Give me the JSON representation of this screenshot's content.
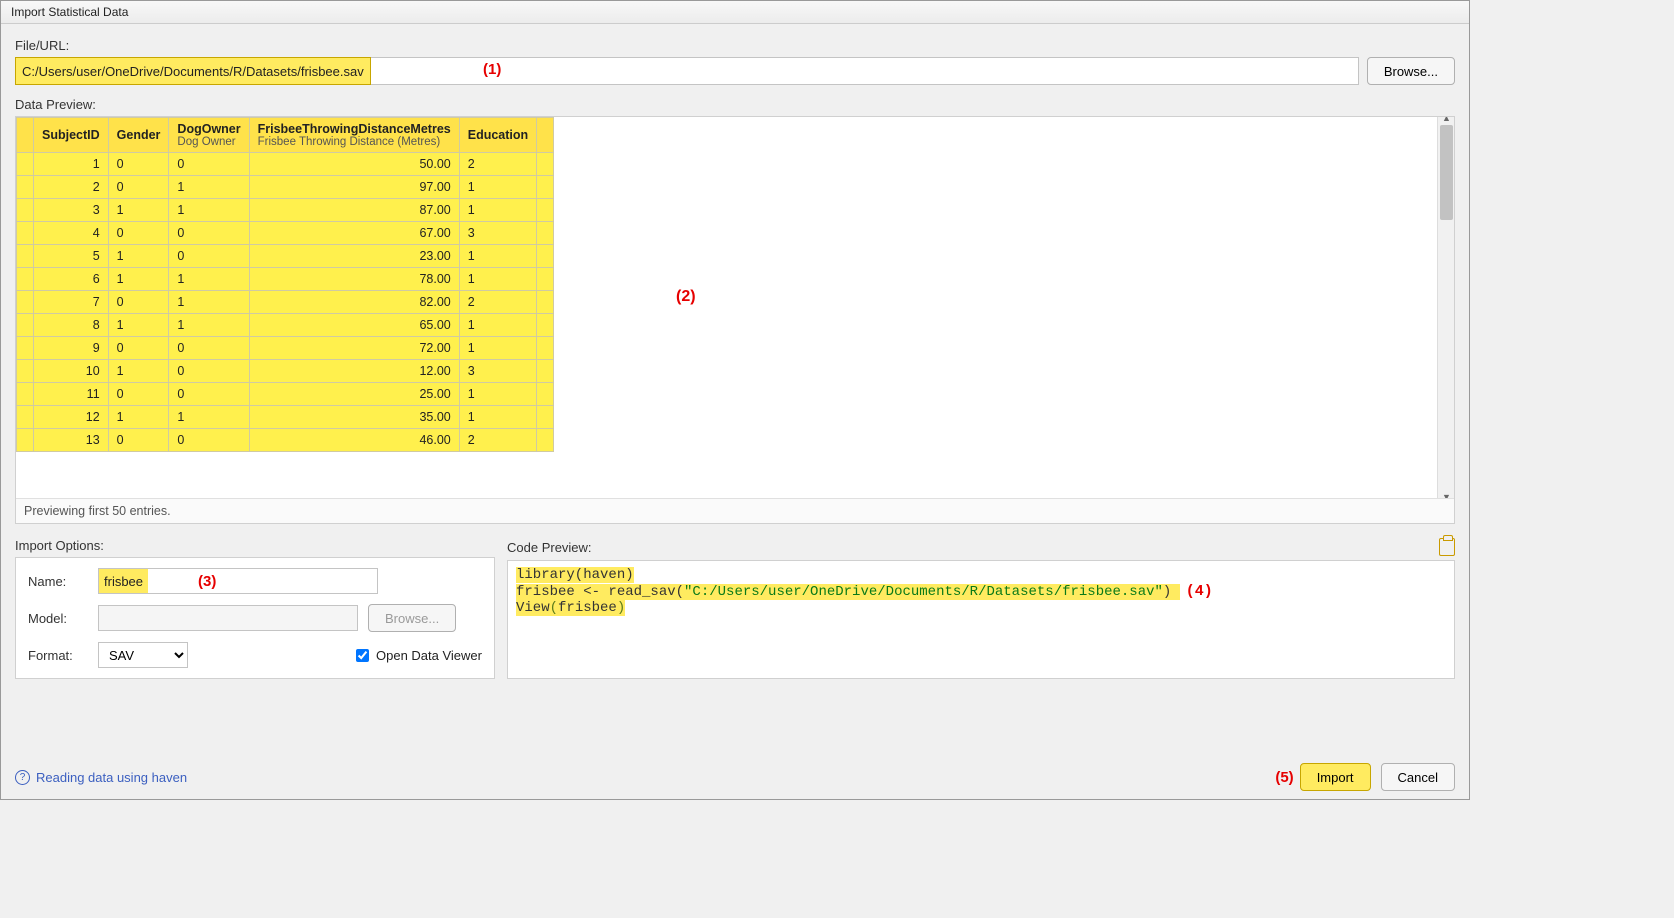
{
  "window_title": "Import Statistical Data",
  "fileurl_label": "File/URL:",
  "fileurl_value": "C:/Users/user/OneDrive/Documents/R/Datasets/frisbee.sav",
  "browse_label": "Browse...",
  "data_preview_label": "Data Preview:",
  "annotation1": "(1)",
  "annotation2": "(2)",
  "annotation3": "(3)",
  "annotation4": "(4)",
  "annotation5": "(5)",
  "columns": [
    {
      "name": "SubjectID",
      "sub": ""
    },
    {
      "name": "Gender",
      "sub": ""
    },
    {
      "name": "DogOwner",
      "sub": "Dog Owner"
    },
    {
      "name": "FrisbeeThrowingDistanceMetres",
      "sub": "Frisbee Throwing Distance (Metres)"
    },
    {
      "name": "Education",
      "sub": ""
    }
  ],
  "rows": [
    {
      "n": "1",
      "g": "0",
      "d": "0",
      "f": "50.00",
      "e": "2"
    },
    {
      "n": "2",
      "g": "0",
      "d": "1",
      "f": "97.00",
      "e": "1"
    },
    {
      "n": "3",
      "g": "1",
      "d": "1",
      "f": "87.00",
      "e": "1"
    },
    {
      "n": "4",
      "g": "0",
      "d": "0",
      "f": "67.00",
      "e": "3"
    },
    {
      "n": "5",
      "g": "1",
      "d": "0",
      "f": "23.00",
      "e": "1"
    },
    {
      "n": "6",
      "g": "1",
      "d": "1",
      "f": "78.00",
      "e": "1"
    },
    {
      "n": "7",
      "g": "0",
      "d": "1",
      "f": "82.00",
      "e": "2"
    },
    {
      "n": "8",
      "g": "1",
      "d": "1",
      "f": "65.00",
      "e": "1"
    },
    {
      "n": "9",
      "g": "0",
      "d": "0",
      "f": "72.00",
      "e": "1"
    },
    {
      "n": "10",
      "g": "1",
      "d": "0",
      "f": "12.00",
      "e": "3"
    },
    {
      "n": "11",
      "g": "0",
      "d": "0",
      "f": "25.00",
      "e": "1"
    },
    {
      "n": "12",
      "g": "1",
      "d": "1",
      "f": "35.00",
      "e": "1"
    },
    {
      "n": "13",
      "g": "0",
      "d": "0",
      "f": "46.00",
      "e": "2"
    }
  ],
  "preview_status": "Previewing first 50 entries.",
  "import_options_title": "Import Options:",
  "io": {
    "name_label": "Name:",
    "name_value": "frisbee",
    "model_label": "Model:",
    "model_value": "",
    "model_browse": "Browse...",
    "format_label": "Format:",
    "format_value": "SAV",
    "open_viewer_label": "Open Data Viewer",
    "open_viewer_checked": true
  },
  "code_preview_title": "Code Preview:",
  "code": {
    "l1": "library(haven)",
    "l2a": "frisbee <- read_sav(",
    "l2b": "\"C:/Users/user/OneDrive/Documents/R/Datasets/frisbee.sav\"",
    "l2c": ")",
    "l3": "View(frisbee)"
  },
  "help_link": "Reading data using haven",
  "import_button": "Import",
  "cancel_button": "Cancel"
}
